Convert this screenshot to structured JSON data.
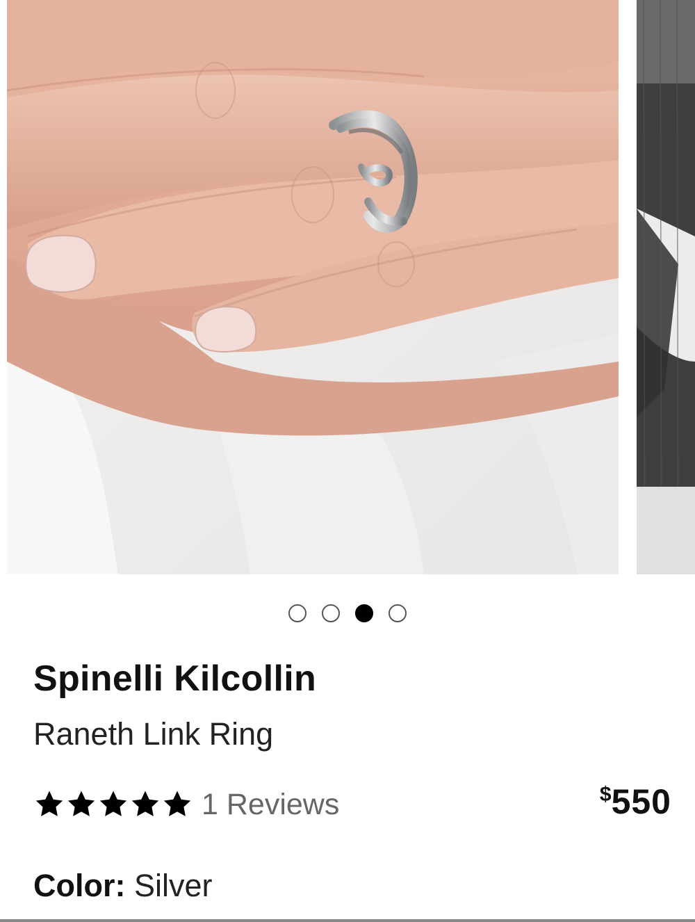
{
  "carousel": {
    "total_slides": 4,
    "active_index": 2,
    "main_image_alt": "Hand wearing silver linked ring",
    "next_image_alt": "Model in gray suit"
  },
  "product": {
    "brand": "Spinelli Kilcollin",
    "name": "Raneth Link Ring",
    "rating": 5,
    "reviews_label": "1 Reviews",
    "price_currency": "$",
    "price_amount": "550",
    "color_label": "Color:",
    "color_value": " Silver"
  },
  "colors": {
    "text_primary": "#111111",
    "text_muted": "#666666",
    "dot_active": "#000000"
  },
  "icons": [
    "star-icon"
  ]
}
